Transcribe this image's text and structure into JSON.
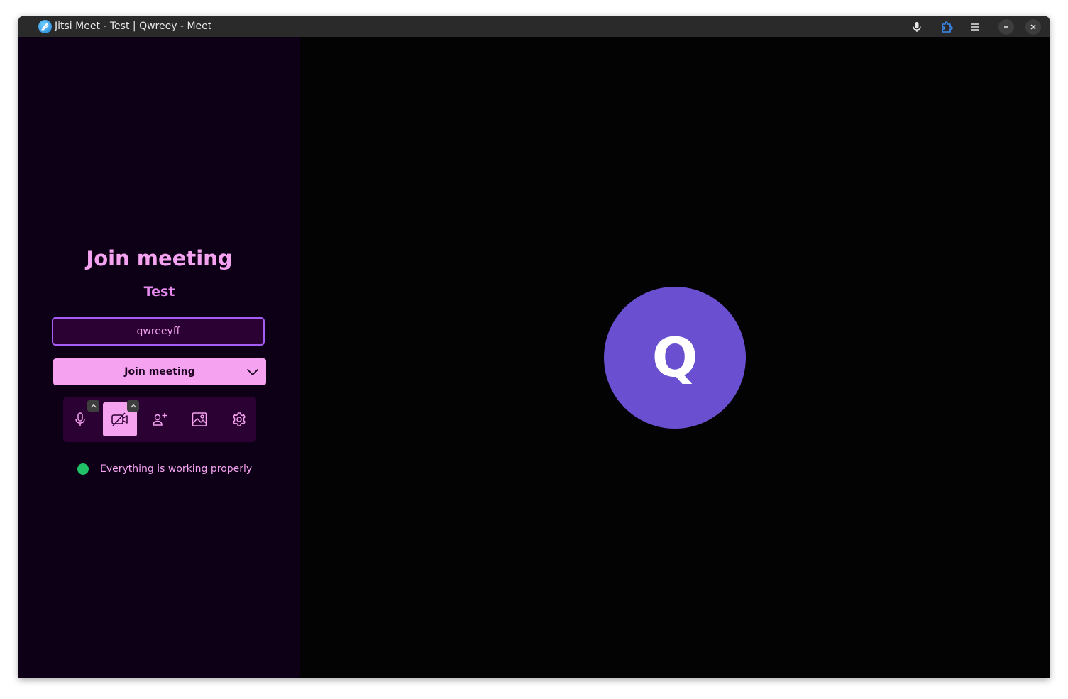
{
  "window": {
    "title": "Jitsi Meet - Test | Qwreey - Meet"
  },
  "titlebar": {
    "icons": [
      "app-logo-icon",
      "microphone-icon",
      "extension-icon",
      "menu-icon",
      "minimize-icon",
      "close-icon"
    ]
  },
  "prejoin": {
    "heading": "Join meeting",
    "room_name": "Test",
    "name_input_value": "qwreeyff",
    "join_button_label": "Join meeting",
    "toolbar": [
      "microphone-icon",
      "camera-off-icon",
      "invite-people-icon",
      "background-image-icon",
      "settings-icon"
    ],
    "status_text": "Everything is working properly"
  },
  "preview": {
    "avatar_initial": "Q"
  },
  "colors": {
    "accent_pink": "#f5a3f0",
    "panel_bg": "#0d0016",
    "toolbar_bg": "#2b0033",
    "input_border": "#a55ef5",
    "avatar_bg": "#6a4fd1",
    "status_ok": "#20c167"
  }
}
